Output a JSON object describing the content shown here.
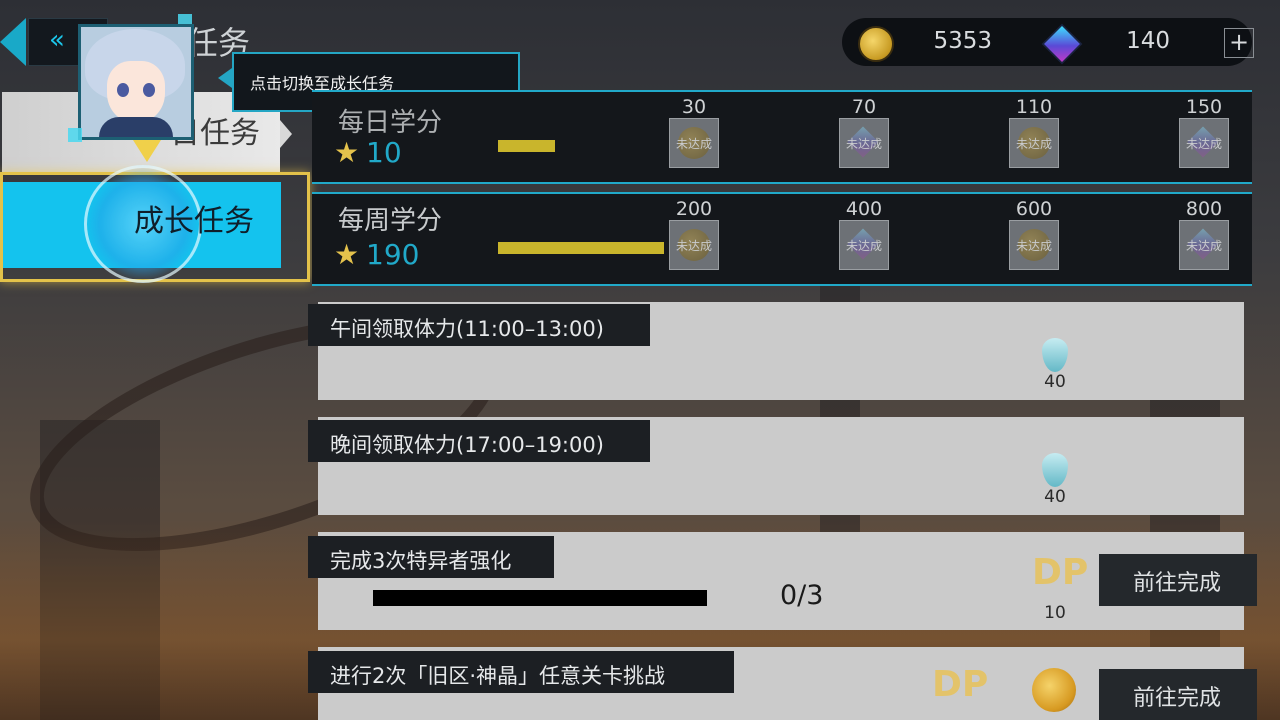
{
  "header": {
    "back_glyph": "«",
    "title": "任务"
  },
  "currency": {
    "coins": "5353",
    "crystals": "140",
    "plus": "+"
  },
  "tabs": {
    "daily": "日任务",
    "growth": "成长任务"
  },
  "tooltip": "点击切换至成长任务",
  "daily_credits": {
    "title": "每日学分",
    "star": "★",
    "value": "10",
    "progress": 0.0,
    "milestones": [
      {
        "num": "30",
        "status": "未达成",
        "icon": "coin-icon"
      },
      {
        "num": "70",
        "status": "未达成",
        "icon": "crystal-icon"
      },
      {
        "num": "110",
        "status": "未达成",
        "icon": "coin-icon"
      },
      {
        "num": "150",
        "status": "未达成",
        "icon": "crystal-icon"
      }
    ]
  },
  "weekly_credits": {
    "title": "每周学分",
    "star": "★",
    "value": "190",
    "milestones": [
      {
        "num": "200",
        "status": "未达成",
        "icon": "coin-icon"
      },
      {
        "num": "400",
        "status": "未达成",
        "icon": "crystal-icon"
      },
      {
        "num": "600",
        "status": "未达成",
        "icon": "coin-icon"
      },
      {
        "num": "800",
        "status": "未达成",
        "icon": "crystal-icon"
      }
    ]
  },
  "tasks": [
    {
      "title": "午间领取体力(11:00–13:00)",
      "reward": "40",
      "reward_icon": "stamina-icon"
    },
    {
      "title": "晚间领取体力(17:00–19:00)",
      "reward": "40",
      "reward_icon": "stamina-icon"
    },
    {
      "title": "完成3次特异者强化",
      "reward": "10",
      "reward_icon": "dp-icon",
      "progress": "0/3",
      "button": "前往完成"
    },
    {
      "title": "进行2次「旧区·神晶」任意关卡挑战",
      "reward_icon": "dp-icon",
      "button": "前往完成"
    }
  ],
  "dp_label": "DP",
  "colors": {
    "accent": "#21a9c9",
    "active_tab": "#14c3ee",
    "highlight": "#e3c24a",
    "credit_bar": "#c9b52c"
  }
}
